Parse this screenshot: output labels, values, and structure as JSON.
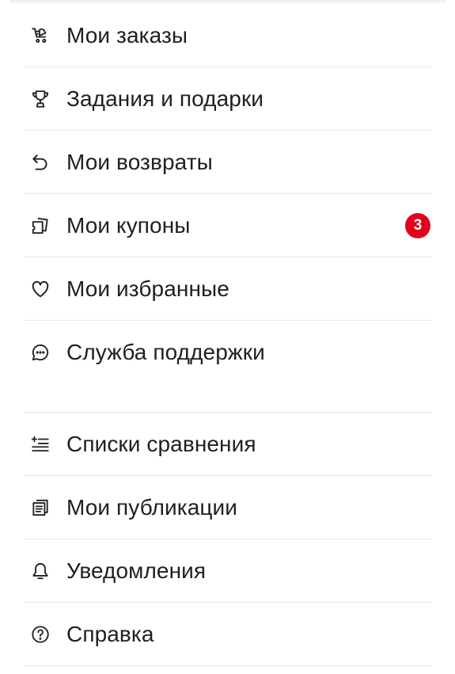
{
  "menu": {
    "group1": [
      {
        "label": "Мои заказы",
        "icon": "cart-icon"
      },
      {
        "label": "Задания и подарки",
        "icon": "trophy-icon"
      },
      {
        "label": "Мои возвраты",
        "icon": "return-arrow-icon"
      },
      {
        "label": "Мои купоны",
        "icon": "coupon-icon",
        "badge": "3"
      },
      {
        "label": "Мои избранные",
        "icon": "heart-icon"
      },
      {
        "label": "Служба поддержки",
        "icon": "chat-bubble-icon"
      }
    ],
    "group2": [
      {
        "label": "Списки сравнения",
        "icon": "compare-list-icon"
      },
      {
        "label": "Мои публикации",
        "icon": "publications-icon"
      },
      {
        "label": "Уведомления",
        "icon": "bell-icon"
      },
      {
        "label": "Справка",
        "icon": "help-circle-icon"
      }
    ]
  },
  "colors": {
    "text": "#21201f",
    "badge": "#e4001b",
    "divider": "#e8e8e8"
  }
}
